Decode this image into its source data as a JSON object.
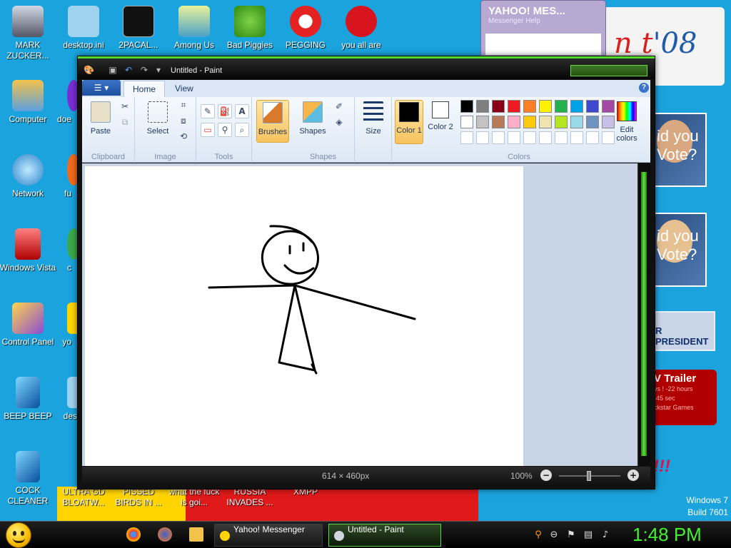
{
  "desktop_icons": [
    {
      "label": "MARK ZUCKER...",
      "icon": "person-icon"
    },
    {
      "label": "desktop.ini",
      "icon": "settings-file-icon"
    },
    {
      "label": "2PACAL...",
      "icon": "terminal-icon"
    },
    {
      "label": "Among Us",
      "icon": "among-us-icon"
    },
    {
      "label": "Bad Piggies",
      "icon": "bad-piggies-icon"
    },
    {
      "label": "PEGGING",
      "icon": "p-logo-icon"
    },
    {
      "label": "you all are",
      "icon": "dev-cpp-icon"
    },
    {
      "label": "Computer",
      "icon": "computer-icon"
    },
    {
      "label": "doe",
      "icon": "app-icon"
    },
    {
      "label": "Network",
      "icon": "network-icon"
    },
    {
      "label": "fu",
      "icon": "app-icon"
    },
    {
      "label": "Windows Vista",
      "icon": "recycle-bin-icon"
    },
    {
      "label": "c",
      "icon": "app-icon"
    },
    {
      "label": "Control Panel",
      "icon": "control-panel-icon"
    },
    {
      "label": "yo",
      "icon": "app-icon"
    },
    {
      "label": "BEEP BEEP",
      "icon": "blue-file-icon"
    },
    {
      "label": "des",
      "icon": "app-icon"
    },
    {
      "label": "COCK CLEANER",
      "icon": "blue-file-icon"
    },
    {
      "label": "ULTRA GD BLOATW...",
      "icon": "app-icon"
    },
    {
      "label": "PISSED BIRDS IN ...",
      "icon": "app-icon"
    },
    {
      "label": "what the fuck is goi...",
      "icon": "app-icon"
    },
    {
      "label": "RUSSIA INVADES ...",
      "icon": "app-icon"
    },
    {
      "label": "XMPP",
      "icon": "app-icon"
    }
  ],
  "wallpaper": {
    "banner_text_a": "n t",
    "banner_text_b": "'08",
    "poster_1": "id you Vote?",
    "poster_2": "id you Vote?",
    "president": "R PRESIDENT",
    "trailer_title": "V Trailer",
    "trailer_line1": "vs ! -22 hours",
    "trailer_line2": "-45 sec",
    "trailer_line3": "ckstar Games",
    "exclaim": "!!!",
    "watermark_os": "Windows 7",
    "watermark_build": "Build 7601"
  },
  "yahoo_window": {
    "title": "YAHOO! MES...",
    "menu": "Messenger  Help"
  },
  "paint": {
    "title": "Untitled - Paint",
    "tabs": [
      "Home",
      "View"
    ],
    "groups": {
      "clipboard": {
        "name": "Clipboard",
        "paste": "Paste"
      },
      "image": {
        "name": "Image",
        "select": "Select"
      },
      "tools": {
        "name": "Tools"
      },
      "brushes": {
        "label": "Brushes"
      },
      "shapes": {
        "name": "Shapes",
        "label": "Shapes"
      },
      "size": {
        "label": "Size"
      },
      "colors": {
        "name": "Colors",
        "color1": "Color 1",
        "color2": "Color 2",
        "edit": "Edit colors",
        "palette_row1": [
          "#000000",
          "#7f7f7f",
          "#880015",
          "#ed1c24",
          "#ff7f27",
          "#fff200",
          "#22b14c",
          "#00a2e8",
          "#3f48cc",
          "#a349a4"
        ],
        "palette_row2": [
          "#ffffff",
          "#c3c3c3",
          "#b97a57",
          "#ffaec9",
          "#ffc90e",
          "#efe4b0",
          "#b5e61d",
          "#99d9ea",
          "#7092be",
          "#c8bfe7"
        ]
      }
    },
    "status": {
      "dimensions": "614 × 460px",
      "zoom": "100%"
    }
  },
  "taskbar": {
    "buttons": [
      {
        "label": "Yahoo! Messenger"
      },
      {
        "label": "Untitled - Paint"
      }
    ],
    "clock": "1:48 PM"
  }
}
